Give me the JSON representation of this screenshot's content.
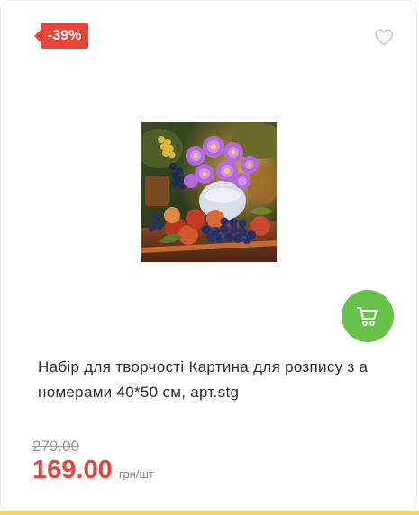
{
  "product": {
    "discount_badge": "-39%",
    "title": "Набір для творчості Картина для розпису з а номерами 40*50 см, арт.stg",
    "old_price": "279.00",
    "price": "169.00",
    "unit": "грн/шт"
  },
  "icons": {
    "favorite": "heart-icon",
    "cart": "cart-icon"
  },
  "colors": {
    "badge": "#e8443a",
    "price": "#e8443a",
    "cart_button": "#66c24a",
    "bottom_strip": "#f6d85a"
  }
}
